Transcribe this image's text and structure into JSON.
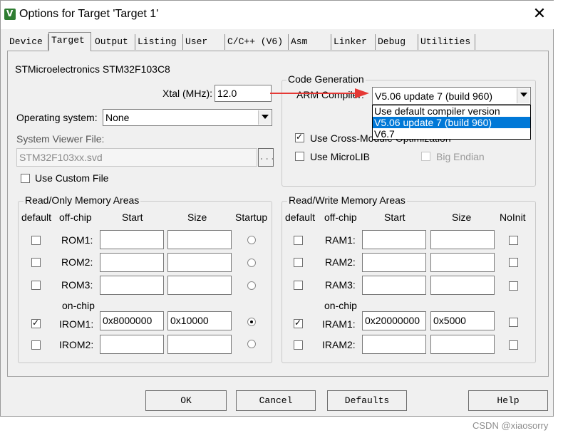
{
  "window": {
    "title": "Options for Target 'Target 1'"
  },
  "tabs": [
    "Device",
    "Target",
    "Output",
    "Listing",
    "User",
    "C/C++ (V6)",
    "Asm",
    "Linker",
    "Debug",
    "Utilities"
  ],
  "active_tab": "Target",
  "device": {
    "name": "STMicroelectronics STM32F103C8"
  },
  "xtal": {
    "label": "Xtal (MHz):",
    "value": "12.0"
  },
  "os": {
    "label": "Operating system:",
    "value": "None"
  },
  "svd": {
    "label": "System Viewer File:",
    "value": "STM32F103xx.svd",
    "browse": "..."
  },
  "custom_file": {
    "label": "Use Custom File",
    "checked": false
  },
  "codegen": {
    "title": "Code Generation",
    "compiler_label": "ARM Compiler:",
    "compiler_value": "V5.06 update 7 (build 960)",
    "dropdown_options": [
      "Use default compiler version",
      "V5.06 update 7 (build 960)",
      "V6.7"
    ],
    "selected_option": "V5.06 update 7 (build 960)",
    "cross_module": {
      "label": "Use Cross-Module Optimization",
      "checked": true
    },
    "microlib": {
      "label": "Use MicroLIB",
      "checked": false
    },
    "big_endian": {
      "label": "Big Endian",
      "checked": false
    }
  },
  "ro_memory": {
    "title": "Read/Only Memory Areas",
    "headers": {
      "default": "default",
      "offchip": "off-chip",
      "start": "Start",
      "size": "Size",
      "startup": "Startup"
    },
    "onchip_label": "on-chip",
    "rows": [
      {
        "name": "ROM1:",
        "default": false,
        "start": "",
        "size": "",
        "startup": false
      },
      {
        "name": "ROM2:",
        "default": false,
        "start": "",
        "size": "",
        "startup": false
      },
      {
        "name": "ROM3:",
        "default": false,
        "start": "",
        "size": "",
        "startup": false
      },
      {
        "name": "IROM1:",
        "default": true,
        "start": "0x8000000",
        "size": "0x10000",
        "startup": true
      },
      {
        "name": "IROM2:",
        "default": false,
        "start": "",
        "size": "",
        "startup": false
      }
    ]
  },
  "rw_memory": {
    "title": "Read/Write Memory Areas",
    "headers": {
      "default": "default",
      "offchip": "off-chip",
      "start": "Start",
      "size": "Size",
      "noinit": "NoInit"
    },
    "onchip_label": "on-chip",
    "rows": [
      {
        "name": "RAM1:",
        "default": false,
        "start": "",
        "size": "",
        "noinit": false
      },
      {
        "name": "RAM2:",
        "default": false,
        "start": "",
        "size": "",
        "noinit": false
      },
      {
        "name": "RAM3:",
        "default": false,
        "start": "",
        "size": "",
        "noinit": false
      },
      {
        "name": "IRAM1:",
        "default": true,
        "start": "0x20000000",
        "size": "0x5000",
        "noinit": false
      },
      {
        "name": "IRAM2:",
        "default": false,
        "start": "",
        "size": "",
        "noinit": false
      }
    ]
  },
  "buttons": {
    "ok": "OK",
    "cancel": "Cancel",
    "defaults": "Defaults",
    "help": "Help"
  },
  "watermark": "CSDN @xiaosorry",
  "colors": {
    "selection": "#0078d7",
    "annotation_arrow": "#e53935"
  }
}
